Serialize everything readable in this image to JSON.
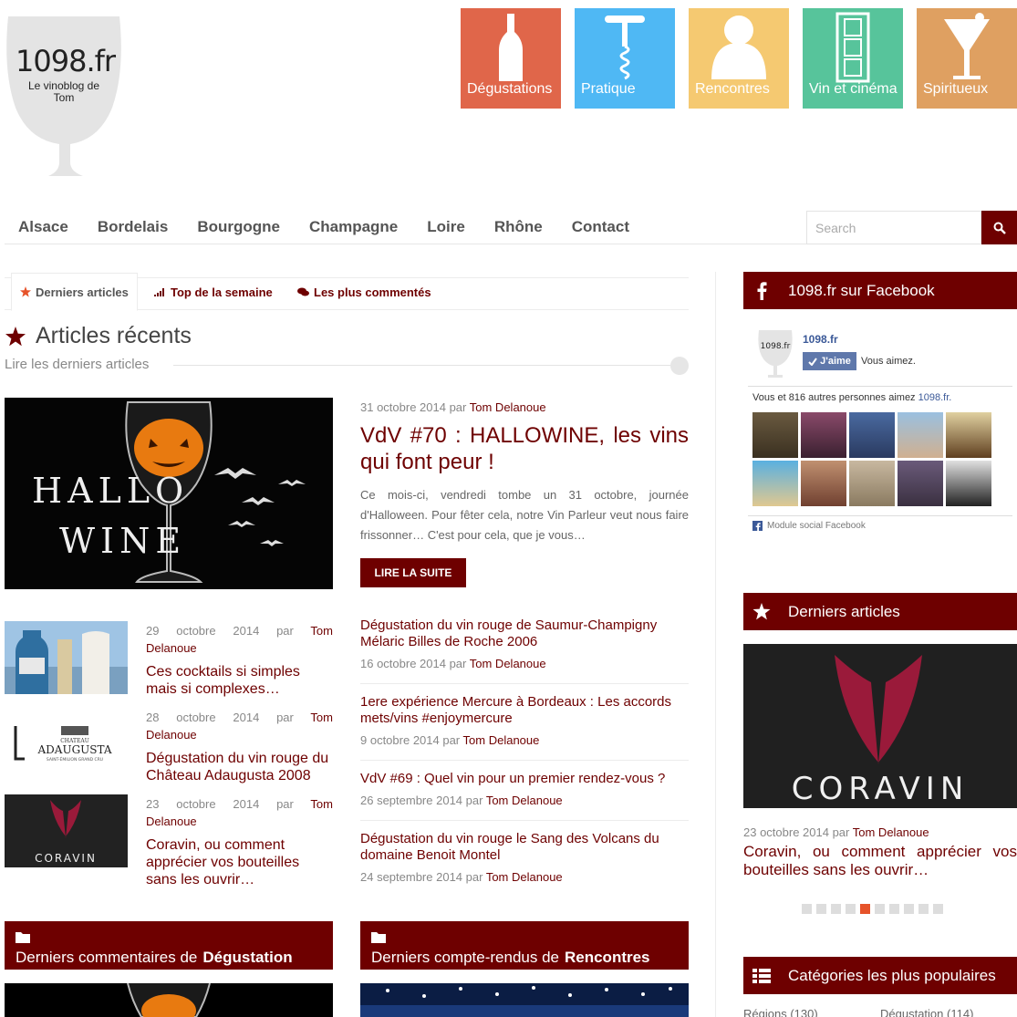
{
  "logo": {
    "title": "1098.fr",
    "subtitle": "Le vinoblog de Tom"
  },
  "category_tiles": [
    {
      "label": "Dégustations",
      "color": "#e0664a",
      "icon": "wine-bottle-icon"
    },
    {
      "label": "Pratique",
      "color": "#4fb8f4",
      "icon": "corkscrew-icon"
    },
    {
      "label": "Rencontres",
      "color": "#f5c971",
      "icon": "people-icon"
    },
    {
      "label": "Vin et cinéma",
      "color": "#57c49b",
      "icon": "film-strip-icon"
    },
    {
      "label": "Spiritueux",
      "color": "#dfa061",
      "icon": "cocktail-glass-icon"
    }
  ],
  "nav": {
    "items": [
      "Alsace",
      "Bordelais",
      "Bourgogne",
      "Champagne",
      "Loire",
      "Rhône",
      "Contact"
    ],
    "search_placeholder": "Search"
  },
  "tabs": [
    "Derniers articles",
    "Top de la semaine",
    "Les plus commentés"
  ],
  "section": {
    "title": "Articles récents",
    "subtitle": "Lire les derniers articles"
  },
  "featured": {
    "date": "31 octobre 2014 par",
    "author": "Tom Delanoue",
    "title": "VdV #70 : HALLOWINE, les vins qui font peur !",
    "excerpt": "Ce mois-ci, vendredi tombe un 31 octobre, journée d'Halloween. Pour fêter cela, notre Vin Parleur veut nous faire frissonner… C'est pour cela, que je vous…",
    "read_more": "LIRE LA SUITE",
    "image_text_1": "HALLO",
    "image_text_2": "WINE"
  },
  "small_articles": [
    {
      "date": "29 octobre 2014 par",
      "author_first": "Tom",
      "author_last": "Delanoue",
      "title": "Ces cocktails si simples mais si complexes…"
    },
    {
      "date": "28 octobre 2014 par",
      "author_first": "Tom",
      "author_last": "Delanoue",
      "title": "Dégustation du vin rouge du Château Adaugusta 2008",
      "thumb_text_1": "CHATEAU",
      "thumb_text_2": "ADAUGUSTA",
      "thumb_text_3": "SAINT-ÉMILION GRAND CRU"
    },
    {
      "date": "23 octobre 2014 par",
      "author_first": "Tom",
      "author_last": "Delanoue",
      "title": "Coravin, ou comment apprécier vos bouteilles sans les ouvrir…",
      "thumb_text": "CORAVIN"
    }
  ],
  "right_list": [
    {
      "title": "Dégustation du vin rouge de Saumur-Champigny Mélaric Billes de Roche 2006",
      "date": "16 octobre 2014 par",
      "author": "Tom Delanoue"
    },
    {
      "title": "1ere expérience Mercure à Bordeaux : Les accords mets/vins #enjoymercure",
      "date": "9 octobre 2014 par",
      "author": "Tom Delanoue"
    },
    {
      "title": "VdV #69 : Quel vin pour un premier rendez-vous ?",
      "date": "26 septembre 2014 par",
      "author": "Tom Delanoue"
    },
    {
      "title": "Dégustation du vin rouge le Sang des Volcans du domaine Benoit Montel",
      "date": "24 septembre 2014 par",
      "author": "Tom Delanoue"
    }
  ],
  "bottom_boxes": [
    {
      "prefix": "Derniers commentaires de",
      "bold": "Dégustation"
    },
    {
      "prefix": "Derniers compte-rendus de",
      "bold": "Rencontres"
    }
  ],
  "sidebar": {
    "facebook": {
      "heading": "1098.fr sur Facebook",
      "page_name": "1098.fr",
      "logo_text": "1098.fr",
      "like_label": "J'aime",
      "liked_text": "Vous aimez.",
      "count_text": "Vous et 816 autres personnes aimez",
      "count_link": "1098.fr.",
      "footer": "Module social Facebook"
    },
    "latest": {
      "heading": "Derniers articles",
      "image_text": "CORAVIN",
      "date": "23 octobre 2014 par",
      "author": "Tom Delanoue",
      "title": "Coravin, ou comment apprécier vos bouteilles sans les ouvrir…",
      "slide_count": 10,
      "active_slide": 4
    },
    "categories": {
      "heading": "Catégories les plus populaires",
      "items": [
        {
          "label": "Régions",
          "count": "(130)"
        },
        {
          "label": "Dégustation",
          "count": "(114)"
        }
      ]
    }
  },
  "colors": {
    "brand": "#6e0000",
    "accent": "#e6532a"
  }
}
